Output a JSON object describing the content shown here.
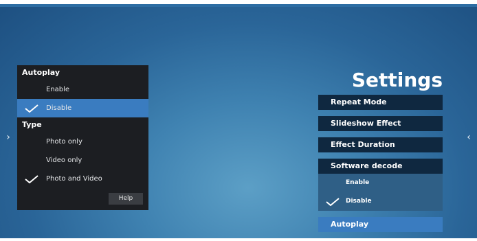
{
  "left_panel": {
    "autoplay_heading": "Autoplay",
    "autoplay_options": [
      {
        "label": "Enable",
        "selected": false
      },
      {
        "label": "Disable",
        "selected": true
      }
    ],
    "type_heading": "Type",
    "type_options": [
      {
        "label": "Photo only",
        "checked": false
      },
      {
        "label": "Video only",
        "checked": false
      },
      {
        "label": "Photo and Video",
        "checked": true
      }
    ],
    "help_label": "Help"
  },
  "settings": {
    "title": "Settings",
    "menu": [
      {
        "label": "Repeat Mode"
      },
      {
        "label": "Slideshow Effect"
      },
      {
        "label": "Effect Duration"
      },
      {
        "label": "Software decode"
      },
      {
        "label": "Autoplay",
        "active": true
      }
    ],
    "software_decode_options": [
      {
        "label": "Enable",
        "checked": false
      },
      {
        "label": "Disable",
        "checked": true
      }
    ]
  },
  "nav": {
    "left_arrow": "›",
    "right_arrow": "‹"
  },
  "colors": {
    "selection": "#3a7cc0",
    "panel_bg": "#1c1e22",
    "menu_bg": "#0f2840",
    "submenu_bg": "#2f5f86"
  }
}
